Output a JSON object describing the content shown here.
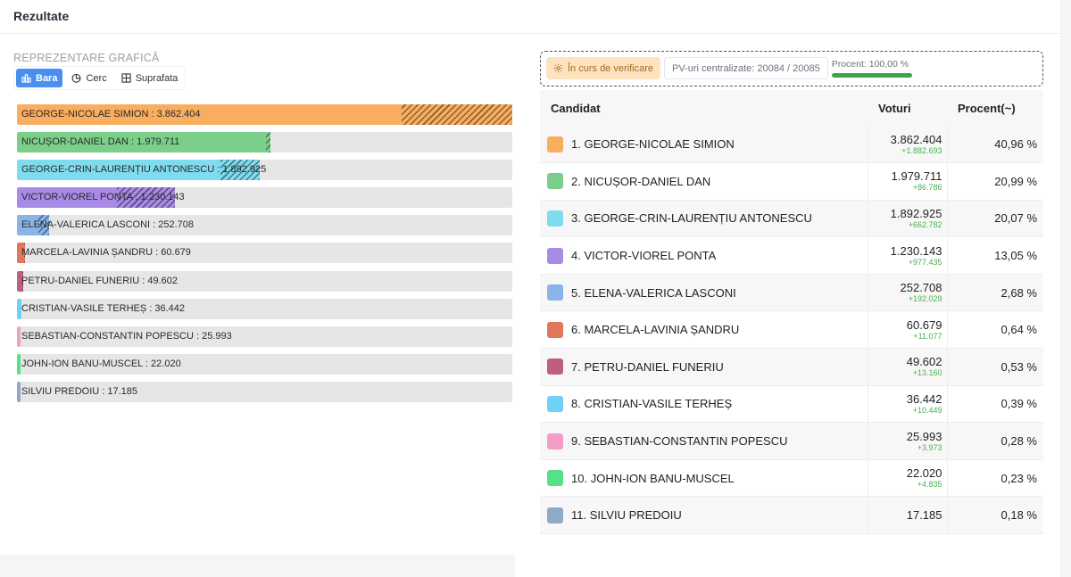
{
  "header": {
    "title": "Rezultate"
  },
  "left_panel": {
    "section_label": "REPREZENTARE GRAFICĂ",
    "tabs": [
      {
        "label": "Bara",
        "icon": "bar-chart-icon",
        "active": true
      },
      {
        "label": "Cerc",
        "icon": "pie-chart-icon",
        "active": false
      },
      {
        "label": "Suprafata",
        "icon": "area-chart-icon",
        "active": false
      }
    ]
  },
  "status": {
    "verification_label": "În curs de verificare",
    "pv_label": "PV-uri centralizate: 20084 / 20085",
    "percent_label": "Procent: 100,00 %",
    "percent_value": 1.0,
    "percent_color": "#3fa34d"
  },
  "table": {
    "headers": {
      "candidate": "Candidat",
      "votes": "Voturi",
      "percent": "Procent(~)"
    }
  },
  "chart_data": {
    "type": "bar",
    "orientation": "horizontal",
    "max_value": 3862404,
    "series": [
      {
        "rank": "1.",
        "name": "GEORGE-NICOLAE SIMION",
        "bar_label": "GEORGE-NICOLAE SIMION : 3.862.404",
        "value": 3862404,
        "votes": "3.862.404",
        "delta": "+1.882.693",
        "delta_value": 1882693,
        "percent": "40,96 %",
        "color": "#f9ad5e"
      },
      {
        "rank": "2.",
        "name": "NICUȘOR-DANIEL DAN",
        "bar_label": "NICUȘOR-DANIEL DAN : 1.979.711",
        "value": 1979711,
        "votes": "1.979.711",
        "delta": "+86.786",
        "delta_value": 86786,
        "percent": "20,99 %",
        "color": "#7bcf8a"
      },
      {
        "rank": "3.",
        "name": "GEORGE-CRIN-LAURENȚIU ANTONESCU",
        "bar_label": "GEORGE-CRIN-LAURENȚIU ANTONESCU : 1.892.925",
        "value": 1892925,
        "votes": "1.892.925",
        "delta": "+662.782",
        "delta_value": 662782,
        "percent": "20,07 %",
        "color": "#7fdcef"
      },
      {
        "rank": "4.",
        "name": "VICTOR-VIOREL PONTA",
        "bar_label": "VICTOR-VIOREL PONTA : 1.230.143",
        "value": 1230143,
        "votes": "1.230.143",
        "delta": "+977.435",
        "delta_value": 977435,
        "percent": "13,05 %",
        "color": "#a98ae6"
      },
      {
        "rank": "5.",
        "name": "ELENA-VALERICA LASCONI",
        "bar_label": "ELENA-VALERICA LASCONI : 252.708",
        "value": 252708,
        "votes": "252.708",
        "delta": "+192.029",
        "delta_value": 192029,
        "percent": "2,68 %",
        "color": "#89b4e8"
      },
      {
        "rank": "6.",
        "name": "MARCELA-LAVINIA ȘANDRU",
        "bar_label": "MARCELA-LAVINIA ȘANDRU : 60.679",
        "value": 60679,
        "votes": "60.679",
        "delta": "+11.077",
        "delta_value": 11077,
        "percent": "0,64 %",
        "color": "#e2775c"
      },
      {
        "rank": "7.",
        "name": "PETRU-DANIEL FUNERIU",
        "bar_label": "PETRU-DANIEL FUNERIU : 49.602",
        "value": 49602,
        "votes": "49.602",
        "delta": "+13.160",
        "delta_value": 13160,
        "percent": "0,53 %",
        "color": "#bf5e7e"
      },
      {
        "rank": "8.",
        "name": "CRISTIAN-VASILE TERHEȘ",
        "bar_label": "CRISTIAN-VASILE TERHEȘ : 36.442",
        "value": 36442,
        "votes": "36.442",
        "delta": "+10.449",
        "delta_value": 10449,
        "percent": "0,39 %",
        "color": "#6ed1f5"
      },
      {
        "rank": "9.",
        "name": "SEBASTIAN-CONSTANTIN POPESCU",
        "bar_label": "SEBASTIAN-CONSTANTIN POPESCU : 25.993",
        "value": 25993,
        "votes": "25.993",
        "delta": "+3.973",
        "delta_value": 3973,
        "percent": "0,28 %",
        "color": "#f29ec8"
      },
      {
        "rank": "10.",
        "name": "JOHN-ION BANU-MUSCEL",
        "bar_label": "JOHN-ION BANU-MUSCEL : 22.020",
        "value": 22020,
        "votes": "22.020",
        "delta": "+4.835",
        "delta_value": 4835,
        "percent": "0,23 %",
        "color": "#56e08a"
      },
      {
        "rank": "11.",
        "name": "SILVIU PREDOIU",
        "bar_label": "SILVIU PREDOIU : 17.185",
        "value": 17185,
        "votes": "17.185",
        "delta": "",
        "delta_value": null,
        "percent": "0,18 %",
        "color": "#8fa9c6"
      }
    ]
  }
}
